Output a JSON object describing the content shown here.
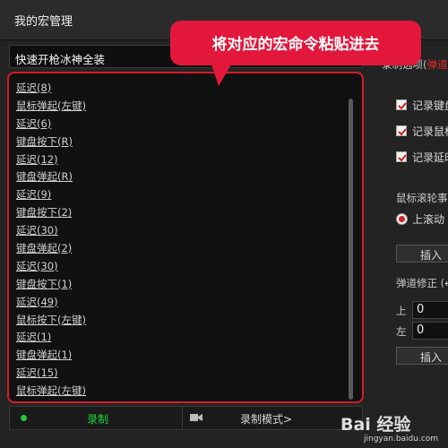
{
  "window": {
    "title": "我的宏管理"
  },
  "macro": {
    "name": "快速开枪冰神全装"
  },
  "list": {
    "items": [
      "延迟(8)",
      "鼠标弹起(左键)",
      "延迟(6)",
      "键盘按下(R)",
      "延迟(12)",
      "键盘弹起(R)",
      "延迟(9)",
      "键盘按下(2)",
      "延迟(30)",
      "键盘弹起(2)",
      "延迟(30)",
      "键盘按下(1)",
      "延迟(49)",
      "鼠标按下(左键)",
      "延迟(1)",
      "键盘弹起(1)",
      "延迟(15)",
      "鼠标弹起(左键)"
    ]
  },
  "recorder": {
    "record_label": "录制",
    "mode_label": "录制模式>"
  },
  "right_panel": {
    "header_prefix": "录制选项(",
    "header_highlight": "弹道",
    "checkboxes": [
      {
        "label": "记录键盘",
        "checked": true
      },
      {
        "label": "记录鼠标",
        "checked": true
      },
      {
        "label": "记录延时",
        "checked": true
      }
    ],
    "wheel_label": "鼠标滚轮事",
    "wheel_option": "上滚动",
    "insert_label": "插入",
    "correction_label": "弹道修正 (←",
    "up_label": "上",
    "up_value": "0",
    "left_label": "左",
    "left_value": "0"
  },
  "annotation": {
    "text": "将对应的宏命令粘贴进去"
  },
  "watermark": {
    "logo": "Bai 经验",
    "site": "jingyan.baidu.com"
  },
  "colors": {
    "accent_red": "#d51c2b",
    "callout": "#e3173c",
    "record_green": "#23d43b"
  }
}
